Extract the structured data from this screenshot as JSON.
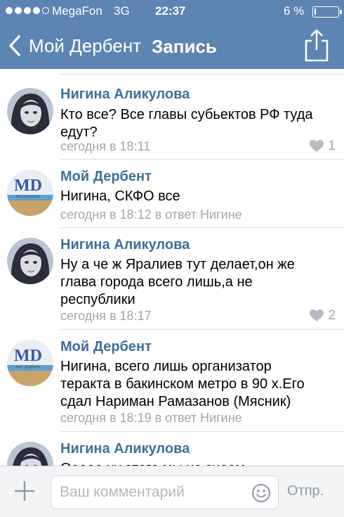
{
  "status_bar": {
    "carrier": "MegaFon",
    "network": "3G",
    "time": "22:37",
    "battery_text": "6 %",
    "battery_level": 0.06,
    "signal_bars_filled": 4,
    "signal_bars_total": 5
  },
  "nav": {
    "back_label": "Мой Дербент",
    "title": "Запись",
    "back_icon": "chevron-left-icon",
    "share_icon": "share-icon"
  },
  "comments": [
    {
      "author": "Нигина Аликулова",
      "text": "Кто все? Все главы субьектов РФ туда едут?",
      "meta": "сегодня в 18:11",
      "likes": "1",
      "avatar": "girl-portrait"
    },
    {
      "author": "Мой Дербент",
      "text": "Нигина, СКФО все",
      "meta": "сегодня в 18:12 в ответ Нигине",
      "likes": "",
      "avatar": "md-logo"
    },
    {
      "author": "Нигина Аликулова",
      "text": "Ну а че ж Яралиев тут делает,он же глава города всего лишь,а не республики",
      "meta": "сегодня в 18:17",
      "likes": "2",
      "avatar": "girl-portrait"
    },
    {
      "author": "Мой Дербент",
      "text": "Нигина, всего лишь организатор теракта в бакинском метро в 90 х.Его сдал Нариман Рамазанов (Мясник)",
      "meta": "сегодня в 18:19 в ответ Нигине",
      "likes": "",
      "avatar": "md-logo"
    },
    {
      "author": "Нигина Аликулова",
      "text": "Ооооо ну этого мы не знаем",
      "meta": "",
      "likes": "",
      "avatar": "girl-portrait"
    }
  ],
  "composer": {
    "placeholder": "Ваш комментарий",
    "value": "",
    "send_label": "Отпр.",
    "attach_icon": "plus-icon",
    "emoji_icon": "smile-icon"
  },
  "colors": {
    "header_bg": "#5d85b3",
    "author": "#3e6f9e",
    "meta": "#a0a7b0",
    "separator": "#dcdfe4"
  }
}
